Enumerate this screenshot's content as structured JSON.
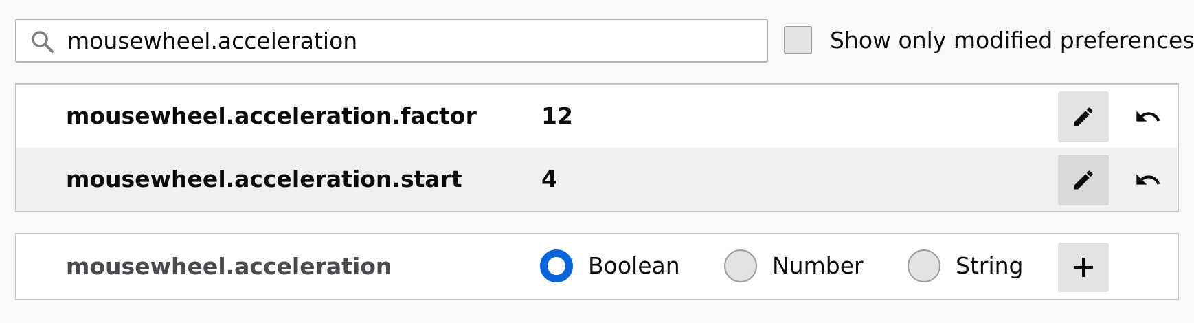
{
  "search": {
    "value": "mousewheel.acceleration"
  },
  "filter": {
    "checked": false,
    "label": "Show only modified preferences"
  },
  "prefs": [
    {
      "name": "mousewheel.acceleration.factor",
      "value": "12"
    },
    {
      "name": "mousewheel.acceleration.start",
      "value": "4"
    }
  ],
  "add_pref": {
    "name": "mousewheel.acceleration",
    "types": [
      {
        "label": "Boolean",
        "selected": true
      },
      {
        "label": "Number",
        "selected": false
      },
      {
        "label": "String",
        "selected": false
      }
    ]
  },
  "colors": {
    "accent": "#0a65dc",
    "button_bg": "#e3e3e5",
    "row_alt_bg": "#f0f0f0",
    "border": "#c4c4c6"
  },
  "icons": {
    "search": "search-icon",
    "edit": "pencil-icon",
    "reset": "undo-icon",
    "add": "plus-icon"
  }
}
